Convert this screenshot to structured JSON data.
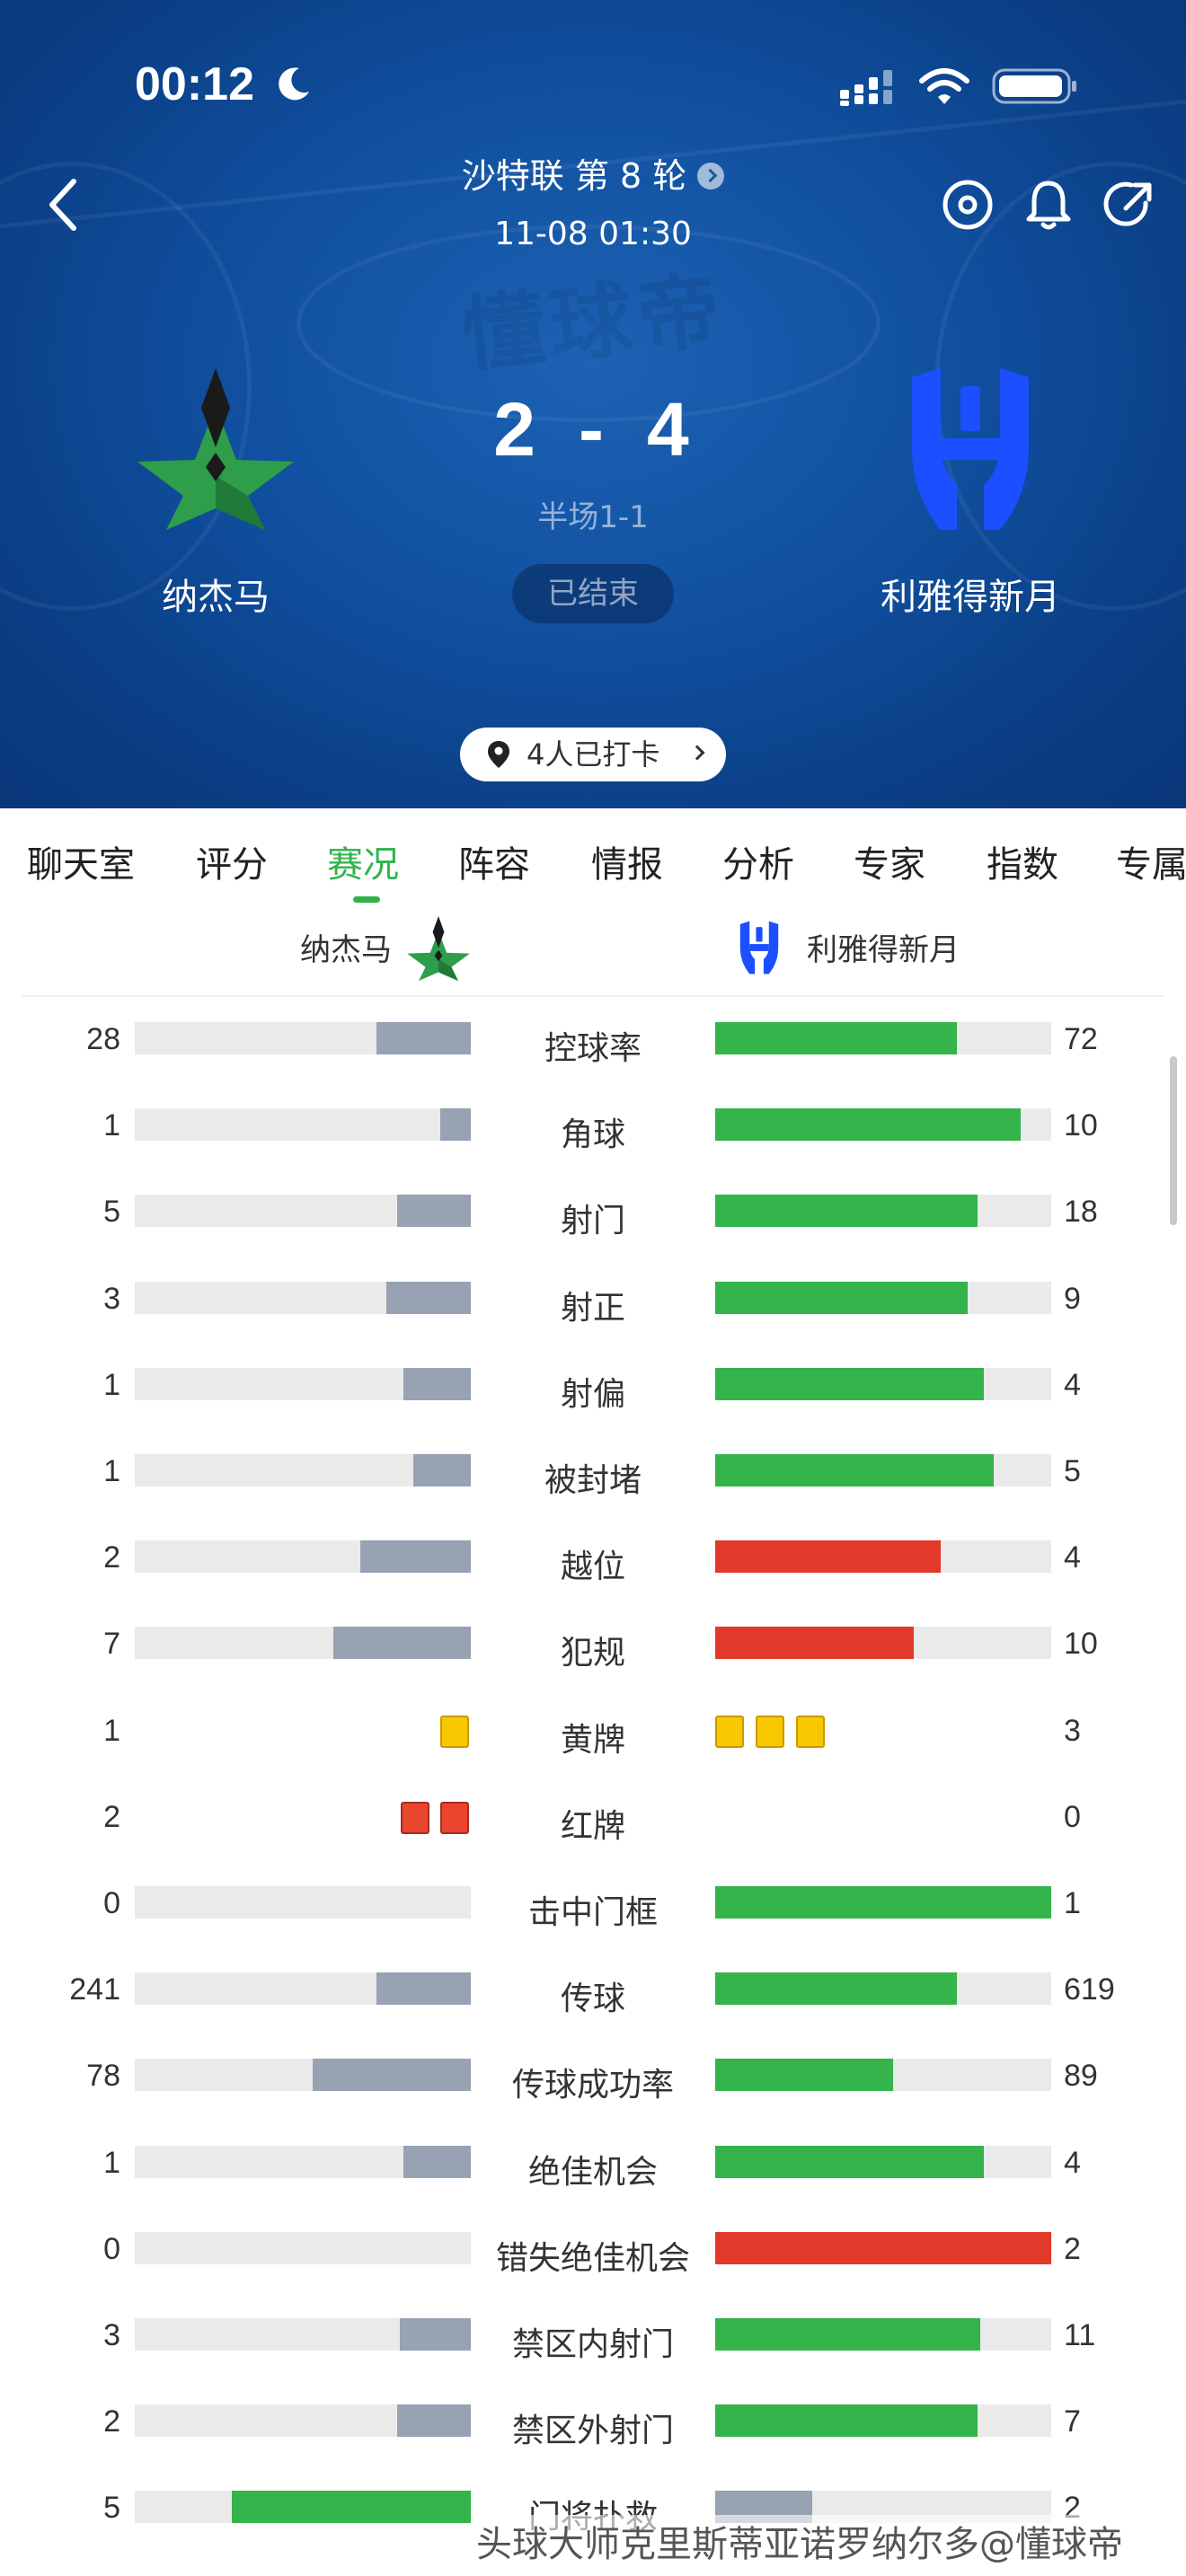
{
  "status_bar": {
    "time": "00:12"
  },
  "header": {
    "league": "沙特联 第 8 轮",
    "match_time": "11-08 01:30",
    "watermark": "懂球帝",
    "home_team": "纳杰马",
    "away_team": "利雅得新月",
    "home_score": "2",
    "away_score": "4",
    "score_separator": "-",
    "halftime": "半场1-1",
    "status": "已结束",
    "checkin": "4人已打卡"
  },
  "tabs": [
    "聊天室",
    "评分",
    "赛况",
    "阵容",
    "情报",
    "分析",
    "专家",
    "指数",
    "专属"
  ],
  "active_tab": "赛况",
  "team_row": {
    "home": "纳杰马",
    "away": "利雅得新月"
  },
  "colors": {
    "home_bar": "#97a2b3",
    "away_bar_green": "#34b44a",
    "away_bar_red": "#e2392a",
    "accent": "#2fb24a"
  },
  "stats": [
    {
      "label": "控球率",
      "home": "28",
      "away": "72",
      "home_ratio": 0.28,
      "away_ratio": 0.72,
      "home_color": "#97a2b3",
      "away_color": "#34b44a"
    },
    {
      "label": "角球",
      "home": "1",
      "away": "10",
      "home_ratio": 0.09,
      "away_ratio": 0.91,
      "home_color": "#97a2b3",
      "away_color": "#34b44a"
    },
    {
      "label": "射门",
      "home": "5",
      "away": "18",
      "home_ratio": 0.22,
      "away_ratio": 0.78,
      "home_color": "#97a2b3",
      "away_color": "#34b44a"
    },
    {
      "label": "射正",
      "home": "3",
      "away": "9",
      "home_ratio": 0.25,
      "away_ratio": 0.75,
      "home_color": "#97a2b3",
      "away_color": "#34b44a"
    },
    {
      "label": "射偏",
      "home": "1",
      "away": "4",
      "home_ratio": 0.2,
      "away_ratio": 0.8,
      "home_color": "#97a2b3",
      "away_color": "#34b44a"
    },
    {
      "label": "被封堵",
      "home": "1",
      "away": "5",
      "home_ratio": 0.17,
      "away_ratio": 0.83,
      "home_color": "#97a2b3",
      "away_color": "#34b44a"
    },
    {
      "label": "越位",
      "home": "2",
      "away": "4",
      "home_ratio": 0.33,
      "away_ratio": 0.67,
      "home_color": "#97a2b3",
      "away_color": "#e2392a"
    },
    {
      "label": "犯规",
      "home": "7",
      "away": "10",
      "home_ratio": 0.41,
      "away_ratio": 0.59,
      "home_color": "#97a2b3",
      "away_color": "#e2392a"
    },
    {
      "label": "黄牌",
      "home": "1",
      "away": "3",
      "cards": {
        "type": "yellow",
        "home": 1,
        "away": 3
      }
    },
    {
      "label": "红牌",
      "home": "2",
      "away": "0",
      "cards": {
        "type": "red",
        "home": 2,
        "away": 0
      }
    },
    {
      "label": "击中门框",
      "home": "0",
      "away": "1",
      "home_ratio": 0,
      "away_ratio": 1,
      "home_color": "#97a2b3",
      "away_color": "#34b44a"
    },
    {
      "label": "传球",
      "home": "241",
      "away": "619",
      "home_ratio": 0.28,
      "away_ratio": 0.72,
      "home_color": "#97a2b3",
      "away_color": "#34b44a"
    },
    {
      "label": "传球成功率",
      "home": "78",
      "away": "89",
      "home_ratio": 0.47,
      "away_ratio": 0.53,
      "home_color": "#97a2b3",
      "away_color": "#34b44a"
    },
    {
      "label": "绝佳机会",
      "home": "1",
      "away": "4",
      "home_ratio": 0.2,
      "away_ratio": 0.8,
      "home_color": "#97a2b3",
      "away_color": "#34b44a"
    },
    {
      "label": "错失绝佳机会",
      "home": "0",
      "away": "2",
      "home_ratio": 0,
      "away_ratio": 1,
      "home_color": "#97a2b3",
      "away_color": "#e2392a"
    },
    {
      "label": "禁区内射门",
      "home": "3",
      "away": "11",
      "home_ratio": 0.21,
      "away_ratio": 0.79,
      "home_color": "#97a2b3",
      "away_color": "#34b44a"
    },
    {
      "label": "禁区外射门",
      "home": "2",
      "away": "7",
      "home_ratio": 0.22,
      "away_ratio": 0.78,
      "home_color": "#97a2b3",
      "away_color": "#34b44a"
    },
    {
      "label": "门将扑救",
      "home": "5",
      "away": "2",
      "home_ratio": 0.71,
      "away_ratio": 0.29,
      "home_color": "#34b44a",
      "away_color": "#97a2b3"
    }
  ],
  "footer_watermark": "头球大师克里斯蒂亚诺罗纳尔多@懂球帝"
}
